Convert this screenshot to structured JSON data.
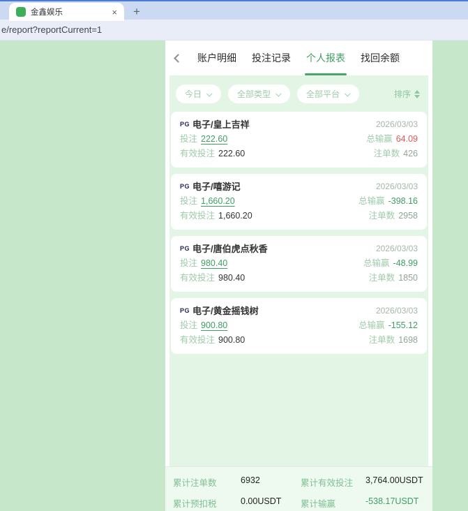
{
  "browser": {
    "tab_title": "金鑫娱乐",
    "close_glyph": "×",
    "new_tab_glyph": "+",
    "url": "e/report?reportCurrent=1"
  },
  "header": {
    "tabs": [
      {
        "label": "账户明细",
        "active": false
      },
      {
        "label": "投注记录",
        "active": false
      },
      {
        "label": "个人报表",
        "active": true
      },
      {
        "label": "找回余额",
        "active": false
      }
    ]
  },
  "filters": {
    "chips": [
      "今日",
      "全部类型",
      "全部平台"
    ],
    "sort_label": "排序"
  },
  "labels": {
    "bet": "投注",
    "winloss": "总输赢",
    "valid": "有效投注",
    "count": "注单数"
  },
  "cards": [
    {
      "provider": "PG",
      "game": "电子/皇上吉祥",
      "date": "2026/03/03",
      "bet": "222.60",
      "winloss": "64.09",
      "winloss_color": "red",
      "valid": "222.60",
      "count": "426"
    },
    {
      "provider": "PG",
      "game": "电子/嘻游记",
      "date": "2026/03/03",
      "bet": "1,660.20",
      "winloss": "-398.16",
      "winloss_color": "green",
      "valid": "1,660.20",
      "count": "2958"
    },
    {
      "provider": "PG",
      "game": "电子/唐伯虎点秋香",
      "date": "2026/03/03",
      "bet": "980.40",
      "winloss": "-48.99",
      "winloss_color": "green",
      "valid": "980.40",
      "count": "1850"
    },
    {
      "provider": "PG",
      "game": "电子/黄金摇钱树",
      "date": "2026/03/03",
      "bet": "900.80",
      "winloss": "-155.12",
      "winloss_color": "green",
      "valid": "900.80",
      "count": "1698"
    }
  ],
  "summary": {
    "items": [
      {
        "label": "累计注单数",
        "value": "6932",
        "color": "dark"
      },
      {
        "label": "累计有效投注",
        "value": "3,764.00USDT",
        "color": "dark"
      },
      {
        "label": "累计预扣税",
        "value": "0.00USDT",
        "color": "dark"
      },
      {
        "label": "累计输赢",
        "value": "-538.17USDT",
        "color": "green"
      }
    ]
  },
  "colors": {
    "page_bg": "#c7e7ca",
    "panel_bg": "#e3f6e5",
    "accent_green": "#3f9e63",
    "label_green": "#9fcbaa",
    "loss_red": "#e25a52",
    "tabbar_blue": "#cbd9f3"
  }
}
